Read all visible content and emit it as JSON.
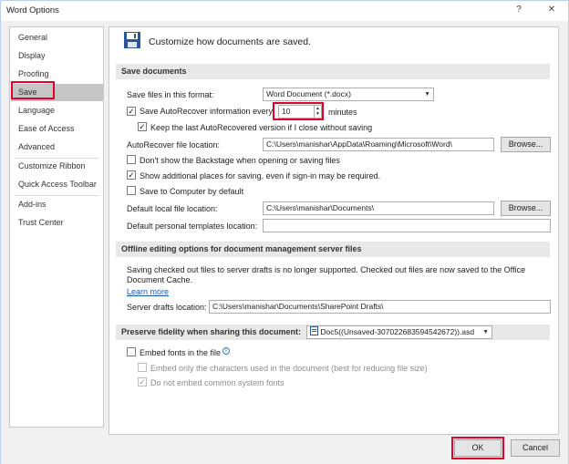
{
  "window": {
    "title": "Word Options",
    "help_glyph": "?",
    "close_glyph": "✕"
  },
  "sidebar": {
    "items": [
      {
        "label": "General"
      },
      {
        "label": "Display"
      },
      {
        "label": "Proofing"
      },
      {
        "label": "Save",
        "selected": true
      },
      {
        "label": "Language"
      },
      {
        "label": "Ease of Access"
      },
      {
        "label": "Advanced"
      },
      {
        "label": "Customize Ribbon"
      },
      {
        "label": "Quick Access Toolbar"
      },
      {
        "label": "Add-ins"
      },
      {
        "label": "Trust Center"
      }
    ]
  },
  "header": {
    "title": "Customize how documents are saved.",
    "icon": "floppy-disk-icon"
  },
  "save_documents": {
    "heading": "Save documents",
    "format_label": "Save files in this format:",
    "format_value": "Word Document (*.docx)",
    "autorecover_label": "Save AutoRecover information every",
    "autorecover_checked": true,
    "autorecover_minutes": "10",
    "minutes_label": "minutes",
    "keep_last_label": "Keep the last AutoRecovered version if I close without saving",
    "keep_last_checked": true,
    "autorecover_location_label": "AutoRecover file location:",
    "autorecover_location_value": "C:\\Users\\manishar\\AppData\\Roaming\\Microsoft\\Word\\",
    "browse_label": "Browse...",
    "no_backstage_label": "Don't show the Backstage when opening or saving files",
    "no_backstage_checked": false,
    "additional_places_label": "Show additional places for saving, even if sign-in may be required.",
    "additional_places_checked": true,
    "save_computer_label": "Save to Computer by default",
    "save_computer_checked": false,
    "default_local_label": "Default local file location:",
    "default_local_value": "C:\\Users\\manishar\\Documents\\",
    "default_templates_label": "Default personal templates location:",
    "default_templates_value": ""
  },
  "offline": {
    "heading": "Offline editing options for document management server files",
    "description_line1": "Saving checked out files to server drafts is no longer supported. Checked out files are now saved to the Office",
    "description_line2": "Document Cache.",
    "learn_more": "Learn more",
    "server_drafts_label": "Server drafts location:",
    "server_drafts_value": "C:\\Users\\manishar\\Documents\\SharePoint Drafts\\"
  },
  "fidelity": {
    "heading": "Preserve fidelity when sharing this document:",
    "document_value": "Doc5((Unsaved-307022683594542672)).asd",
    "embed_fonts_label": "Embed fonts in the file",
    "embed_fonts_checked": false,
    "embed_only_label": "Embed only the characters used in the document (best for reducing file size)",
    "no_common_label": "Do not embed common system fonts",
    "no_common_checked": true
  },
  "buttons": {
    "ok": "OK",
    "cancel": "Cancel"
  },
  "glyphs": {
    "check": "✓",
    "dropdown": "▼",
    "spin_up": "▲",
    "spin_down": "▼",
    "info": "i"
  },
  "colors": {
    "highlight": "#e4002b",
    "selected_nav": "#c5c5c5",
    "link": "#1a5ab0"
  }
}
